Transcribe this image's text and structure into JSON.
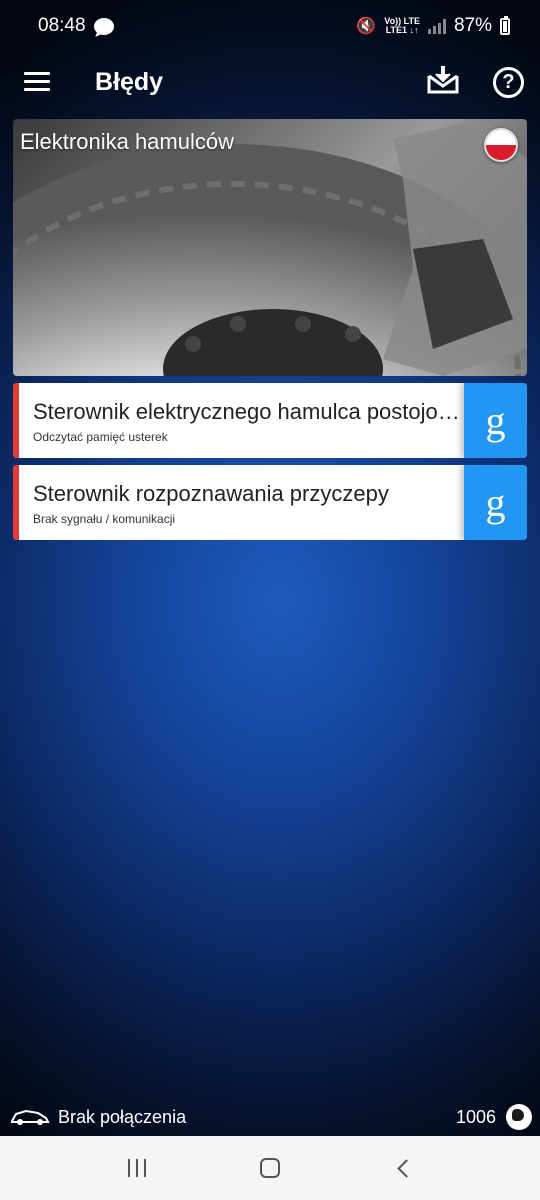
{
  "status_bar": {
    "time": "08:48",
    "network_top": "Vo)) LTE",
    "network_bottom": "LTE1 ↓↑",
    "battery": "87%"
  },
  "app_bar": {
    "title": "Błędy",
    "icons": [
      "menu-icon",
      "download-tray-icon",
      "help-icon"
    ]
  },
  "banner": {
    "title": "Elektronika hamulców",
    "flag": "poland-flag"
  },
  "modules": [
    {
      "name": "Sterownik elektrycznego hamulca postojowego",
      "status": "Odczytać pamięć usterek",
      "action": "g"
    },
    {
      "name": "Sterownik rozpoznawania przyczepy",
      "status": "Brak sygnału / komunikacji",
      "action": "g"
    }
  ],
  "colors": {
    "accent_button": "#2196f3",
    "error_bar": "#e53935"
  },
  "footer": {
    "connection": "Brak połączenia",
    "count": "1006"
  }
}
